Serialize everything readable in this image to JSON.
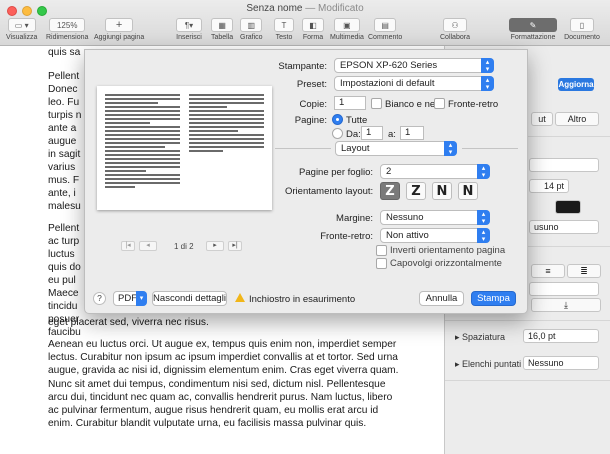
{
  "window": {
    "title": "Senza nome",
    "status": "— Modificato"
  },
  "toolbar": {
    "items": [
      {
        "id": "visualizza",
        "label": "Visualizza",
        "icon": "sidebar-icon"
      },
      {
        "id": "ridimensiona",
        "label": "Ridimensiona",
        "value": "125%"
      },
      {
        "id": "aggiungi",
        "label": "Aggiungi pagina",
        "icon": "plus-icon"
      },
      {
        "id": "inserisci",
        "label": "Inserisci",
        "icon": "paragraph-icon"
      },
      {
        "id": "tabella",
        "label": "Tabella",
        "icon": "table-icon"
      },
      {
        "id": "grafico",
        "label": "Grafico",
        "icon": "chart-icon"
      },
      {
        "id": "testo",
        "label": "Testo",
        "icon": "text-icon"
      },
      {
        "id": "forma",
        "label": "Forma",
        "icon": "shape-icon"
      },
      {
        "id": "multimedia",
        "label": "Multimedia",
        "icon": "media-icon"
      },
      {
        "id": "commento",
        "label": "Commento",
        "icon": "comment-icon"
      },
      {
        "id": "collabora",
        "label": "Collabora",
        "icon": "collaborate-icon"
      },
      {
        "id": "formattazione",
        "label": "Formattazione",
        "icon": "brush-icon"
      },
      {
        "id": "documento",
        "label": "Documento",
        "icon": "document-icon"
      }
    ]
  },
  "document": {
    "top_fragment": "quis sa",
    "fragments_block1": [
      "Pellent",
      "Donec",
      "leo. Fu",
      "turpis n",
      "ante a",
      "augue",
      "in sagit",
      "varius",
      "mus. F",
      "ante, i",
      "malesu"
    ],
    "fragments_block2": [
      "Pellent",
      "ac turp",
      "luctus",
      "quis do",
      "eu pul",
      "Maece",
      "tincidu",
      "posuer",
      "faucibu"
    ],
    "line_after_dialog": "eget placerat sed, viverra nec risus.",
    "paragraph": [
      "Aenean eu luctus orci. Ut augue ex, tempus quis enim non, imperdiet semper",
      "lectus. Curabitur non ipsum ac ipsum imperdiet convallis at et tortor. Sed urna",
      "augue, gravida ac nisi id, dignissim elementum enim. Cras eget viverra quam.",
      "Nunc sit amet dui tempus, condimentum nisi sed, dictum nisl. Pellentesque",
      "arcu dui, tincidunt nec quam ac, convallis hendrerit purus. Nam luctus, libero",
      "ac pulvinar fermentum, augue risus hendrerit quam, eu mollis erat arcu id",
      "enim. Curabitur blandit vulputate urna, eu facilisis massa pulvinar quis."
    ]
  },
  "sidebar": {
    "update_button": "Aggiorna",
    "tab_a": "ut",
    "tab_b": "Altro",
    "font_size": "14 pt",
    "line_value": "usuno",
    "spacing_label": "Spaziatura",
    "spacing_value": "16,0 pt",
    "bullets_label": "Elenchi puntati",
    "bullets_value": "Nessuno"
  },
  "print_dialog": {
    "printer_label": "Stampante:",
    "printer_value": "EPSON XP-620 Series",
    "preset_label": "Preset:",
    "preset_value": "Impostazioni di default",
    "copies_label": "Copie:",
    "copies_value": "1",
    "bw_label": "Bianco e nero",
    "duplex_label": "Fronte-retro",
    "pages_label": "Pagine:",
    "pages_all": "Tutte",
    "pages_from": "Da:",
    "from_value": "1",
    "pages_to": "a:",
    "to_value": "1",
    "section_value": "Layout",
    "pages_per_sheet_label": "Pagine per foglio:",
    "pages_per_sheet_value": "2",
    "orientation_label": "Orientamento layout:",
    "orientation_glyphs": [
      "Z",
      "Z",
      "N",
      "N"
    ],
    "border_label": "Margine:",
    "border_value": "Nessuno",
    "two_sided_label": "Fronte-retro:",
    "two_sided_value": "Non attivo",
    "reverse_label": "Inverti orientamento pagina",
    "flip_label": "Capovolgi orizzontalmente",
    "page_counter": "1 di 2",
    "help_label": "?",
    "pdf_label": "PDF",
    "hide_details_label": "Nascondi dettagli",
    "ink_warning": "Inchiostro in esaurimento",
    "cancel_label": "Annulla",
    "print_label": "Stampa"
  },
  "colors": {
    "accent": "#2f7ef0",
    "warning": "#f1b619",
    "spell_error": "#e23b3b"
  }
}
